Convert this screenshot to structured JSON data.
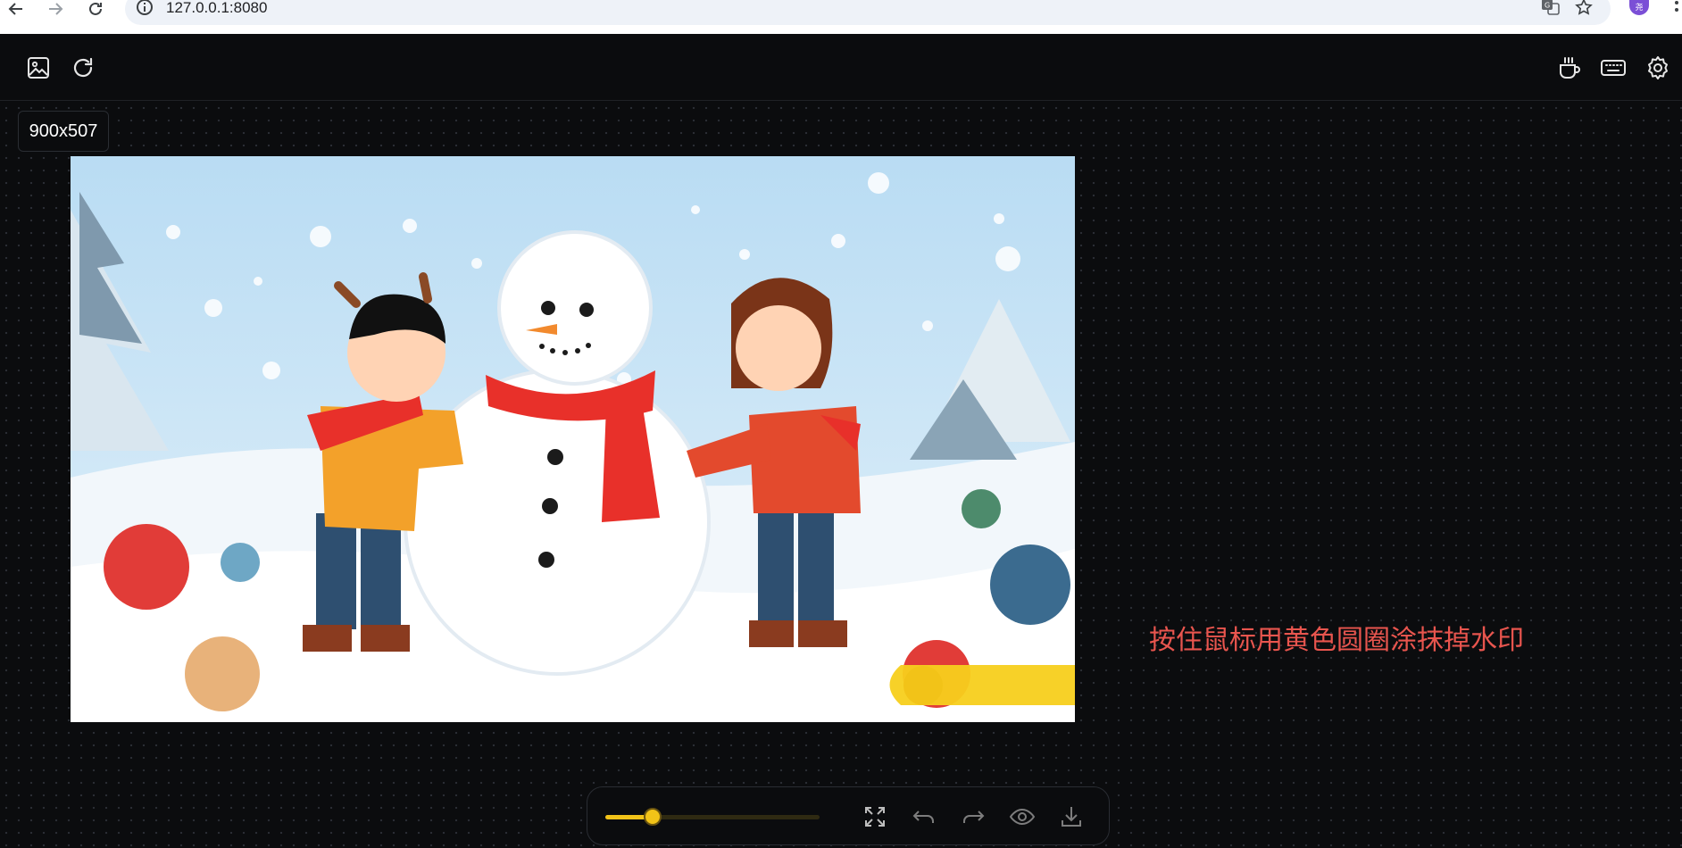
{
  "browser": {
    "url": "127.0.0.1:8080",
    "profile_initial": "尧",
    "icons": [
      "back-arrow-icon",
      "forward-arrow-icon",
      "reload-icon",
      "info-icon",
      "translate-icon",
      "star-icon",
      "kebab-menu-icon"
    ]
  },
  "toolbar": {
    "left_icons": [
      "image-upload-icon",
      "refresh-icon"
    ],
    "right_icons": [
      "coffee-cup-icon",
      "keyboard-icon",
      "gear-icon"
    ]
  },
  "canvas": {
    "size_label": "900x507",
    "hint": "按住鼠标用黄色圆圈涂抹掉水印",
    "image_alt": "Snowman illustration with two children"
  },
  "bottom_toolbar": {
    "brush_size_fraction": 0.22,
    "icons": [
      "fit-to-screen-icon",
      "undo-icon",
      "redo-icon",
      "eye-icon",
      "download-icon"
    ]
  },
  "colors": {
    "accent": "#f2c318",
    "hint": "#e8554e",
    "background": "#0b0c0e"
  }
}
